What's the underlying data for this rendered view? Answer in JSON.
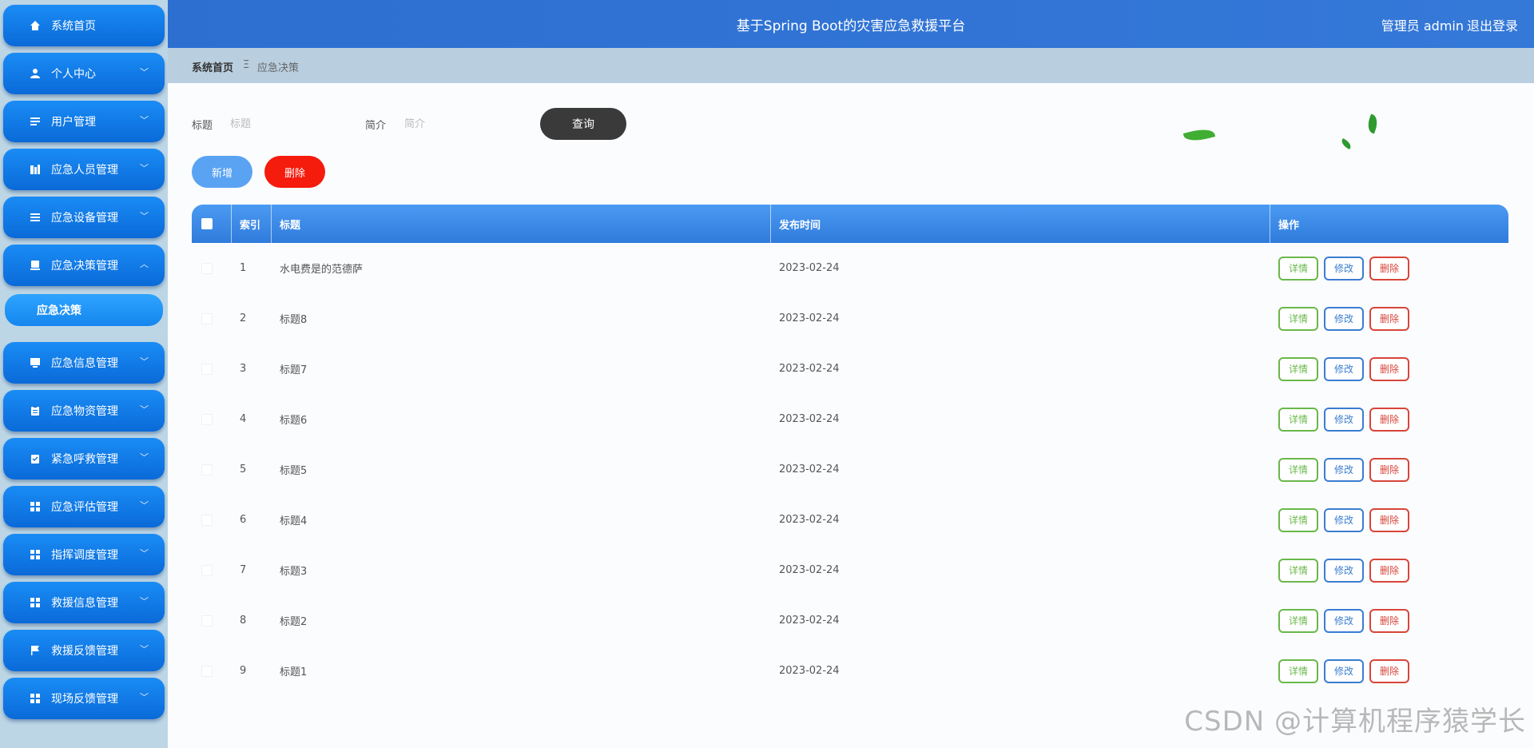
{
  "sidebar": {
    "items": [
      {
        "label": "系统首页",
        "icon": "home-icon"
      },
      {
        "label": "个人中心",
        "icon": "user-icon"
      },
      {
        "label": "用户管理",
        "icon": "list-icon"
      },
      {
        "label": "应急人员管理",
        "icon": "building-icon"
      },
      {
        "label": "应急设备管理",
        "icon": "menu-icon"
      },
      {
        "label": "应急决策管理",
        "icon": "tray-icon"
      },
      {
        "label": "应急信息管理",
        "icon": "monitor-icon"
      },
      {
        "label": "应急物资管理",
        "icon": "clipboard-icon"
      },
      {
        "label": "紧急呼救管理",
        "icon": "checklist-icon"
      },
      {
        "label": "应急评估管理",
        "icon": "grid-icon"
      },
      {
        "label": "指挥调度管理",
        "icon": "grid-icon"
      },
      {
        "label": "救援信息管理",
        "icon": "grid-icon"
      },
      {
        "label": "救援反馈管理",
        "icon": "flag-icon"
      },
      {
        "label": "现场反馈管理",
        "icon": "grid-icon"
      }
    ],
    "active_sub": "应急决策"
  },
  "header": {
    "title": "基于Spring Boot的灾害应急救援平台",
    "user": "管理员 admin",
    "logout": "退出登录"
  },
  "breadcrumb": {
    "home": "系统首页",
    "separator": "Ξ",
    "current": "应急决策"
  },
  "search": {
    "title_label": "标题",
    "title_placeholder": "标题",
    "intro_label": "简介",
    "intro_placeholder": "简介",
    "query": "查询"
  },
  "actions": {
    "add": "新增",
    "delete": "删除"
  },
  "table": {
    "headers": {
      "index": "索引",
      "title": "标题",
      "date": "发布时间",
      "ops": "操作"
    },
    "ops": {
      "detail": "详情",
      "edit": "修改",
      "delete": "删除"
    },
    "rows": [
      {
        "index": "1",
        "title": "水电费是的范德萨",
        "date": "2023-02-24"
      },
      {
        "index": "2",
        "title": "标题8",
        "date": "2023-02-24"
      },
      {
        "index": "3",
        "title": "标题7",
        "date": "2023-02-24"
      },
      {
        "index": "4",
        "title": "标题6",
        "date": "2023-02-24"
      },
      {
        "index": "5",
        "title": "标题5",
        "date": "2023-02-24"
      },
      {
        "index": "6",
        "title": "标题4",
        "date": "2023-02-24"
      },
      {
        "index": "7",
        "title": "标题3",
        "date": "2023-02-24"
      },
      {
        "index": "8",
        "title": "标题2",
        "date": "2023-02-24"
      },
      {
        "index": "9",
        "title": "标题1",
        "date": "2023-02-24"
      }
    ]
  },
  "watermark": "CSDN @计算机程序猿学长",
  "colors": {
    "header": "#2d6fd1",
    "nav": "#0a6ad8",
    "query": "#3a3a3a",
    "add": "#5aa3f3",
    "delete": "#f51b0d"
  }
}
